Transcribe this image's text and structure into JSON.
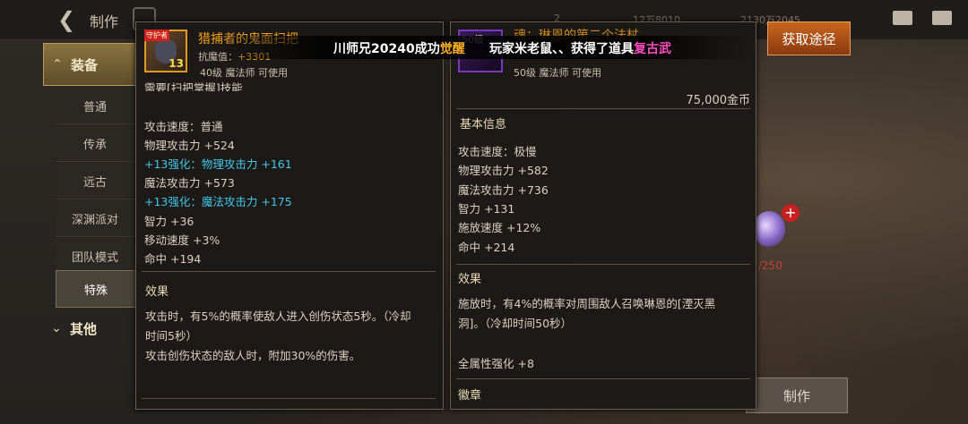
{
  "topbar": {
    "back_icon": "back-arrow-icon",
    "title": "制作",
    "home_icon": "home-icon",
    "dim_numbers": [
      "2",
      "12万8010",
      "2130万2045"
    ]
  },
  "sidebar": {
    "category_equipment": "装备",
    "items": [
      "普通",
      "传承",
      "远古",
      "深渊派对",
      "团队模式",
      "特殊"
    ],
    "category_other": "其他"
  },
  "item1": {
    "name": "猎捕者的鬼面扫把",
    "tag": "守护者",
    "level_badge": "13",
    "anti_magic_label": "抗魔值：",
    "anti_magic_value": "+3301",
    "req": "40级 魔法师 可使用",
    "cut_line": "需要[扫把掌握]技能",
    "stats": [
      {
        "text": "攻击速度：普通",
        "color": "normal"
      },
      {
        "text": "物理攻击力 +524",
        "color": "normal"
      },
      {
        "text": "+13强化：物理攻击力 +161",
        "color": "cyan"
      },
      {
        "text": "魔法攻击力 +573",
        "color": "normal"
      },
      {
        "text": "+13强化：魔法攻击力 +175",
        "color": "cyan"
      },
      {
        "text": "智力 +36",
        "color": "normal"
      },
      {
        "text": "移动速度 +3%",
        "color": "normal"
      },
      {
        "text": "命中 +194",
        "color": "normal"
      }
    ],
    "effect_header": "效果",
    "effect_lines": [
      "攻击时，有5%的概率使敌人进入创伤状态5秒。（冷却",
      "时间5秒）",
      "攻击创伤状态的敌人时，附加30%的伤害。"
    ]
  },
  "item2": {
    "level_badge": "50级",
    "name": "魂：琳恩的第二个法杖",
    "req": "50级 魔法师 可使用",
    "price": "75,000金币",
    "basic_header": "基本信息",
    "stats": [
      "攻击速度：极慢",
      "物理攻击力 +582",
      "魔法攻击力 +736",
      "智力 +131",
      "施放速度 +12%",
      "命中 +214"
    ],
    "effect_header": "效果",
    "effect_lines": [
      "施放时，有4%的概率对周围敌人召唤琳恩的[湮灭黑",
      "洞]。（冷却时间50秒）"
    ],
    "all_attr": "全属性强化 +8",
    "badge_header": "徽章"
  },
  "banner": {
    "part1": "川师兄20240成功",
    "part1_hl": "觉醒",
    "part2": "玩家米老鼠、、获得了道具",
    "part2_hl": "复古武"
  },
  "buttons": {
    "acquire": "获取途径",
    "make": "制作"
  },
  "right": {
    "red_text": "/250"
  },
  "colors": {
    "orange": "#f0a020",
    "cyan": "#40c8e8",
    "gold_banner": "#ffb020",
    "pink": "#ff4ac0"
  }
}
